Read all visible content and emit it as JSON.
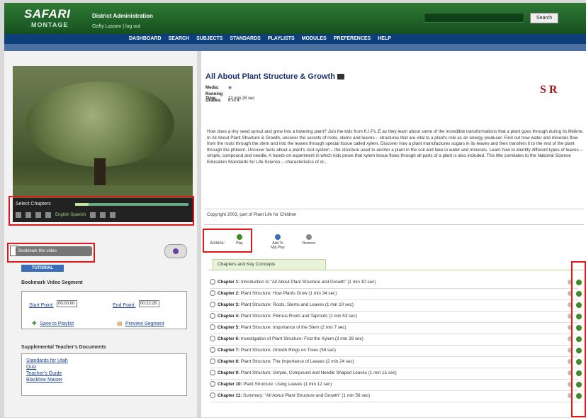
{
  "header": {
    "logo_top": "SAFARI",
    "logo_bottom": "MONTAGE",
    "district": "District Administration",
    "user_line": "Gefty Lassen  |  log out",
    "search_button": "Search"
  },
  "nav": [
    "DASHBOARD",
    "SEARCH",
    "SUBJECTS",
    "STANDARDS",
    "PLAYLISTS",
    "MODULES",
    "PREFERENCES",
    "HELP"
  ],
  "player": {
    "label": "Select  Chapters",
    "language": "English  Spanish",
    "progress": 0.12
  },
  "left": {
    "bookmark_button": "Bookmark this video",
    "tutorial": "TUTORIAL",
    "bookmark_segment_title": "Bookmark Video Segment",
    "start_label": "Start Point:",
    "start_value": "00:00:00",
    "end_label": "End Point:",
    "end_value": "00:22:28",
    "save_link": "Save to Playlist",
    "preview_link": "Preview Segment",
    "docs_title": "Supplemental Teacher's Documents",
    "docs": [
      "Standards for Utah",
      "Quiz",
      "Teacher's Guide",
      "Blackline Master"
    ]
  },
  "video_info": {
    "title": "All About Plant Structure & Growth",
    "media_label": "Media:",
    "running_time_label": "Running Time:",
    "running_time": "22 min 28 sec",
    "grades_label": "Grades:",
    "grades": "K to 4",
    "brand": "S R",
    "description": "How does a tiny seed sprout and grow into a towering plant? Join the kids from K.I.P.L.E as they learn about some of the incredible transformations that a plant goes through during its lifetime. In All About Plant Structure & Growth, uncover the secrets of roots, stems and leaves – structures that are vital to a plant's role as an energy producer. Find out how water and minerals flow from the roots through the stem and into the leaves through special tissue called xylem. Discover how a plant manufactures sugars in its leaves and then transfers it to the rest of the plant through the phloem. Uncover facts about a plant's root system – the structure used to anchor a plant in the soil and take in water and minerals. Learn how to identify different types of leaves – simple, compound and needle. A hands-on experiment in which kids prove that xylem tissue flows through all parts of a plant is also included. This title correlates to the National Science Education Standards for Life Science – characteristics of or...",
    "copyright": "Copyright 2003, part of Plant Life for Children",
    "actions_label": "Actions:",
    "actions": [
      "Play",
      "Add To MyLPlay",
      "Remove"
    ],
    "tab": "Chapters and Key Concepts"
  },
  "chapters": [
    {
      "num": "Chapter 1:",
      "text": "Introduction to \"All About Plant Structure and Growth\" (1 min 10 sec)"
    },
    {
      "num": "Chapter 2:",
      "text": "Plant Structure: How Plants Grow (1 min 34 sec)"
    },
    {
      "num": "Chapter 3:",
      "text": "Plant Structure: Roots, Stems and Leaves (1 min 10 sec)"
    },
    {
      "num": "Chapter 4:",
      "text": "Plant Structure: Fibrous Roots and Taproots (2 min 53 sec)"
    },
    {
      "num": "Chapter 5:",
      "text": "Plant Structure: Importance of the Stem (2 min 7 sec)"
    },
    {
      "num": "Chapter 6:",
      "text": "Investigation of Plant Structure: Find the Xylem (3 min 28 sec)"
    },
    {
      "num": "Chapter 7:",
      "text": "Plant Structure: Growth Rings on Trees (59 sec)"
    },
    {
      "num": "Chapter 8:",
      "text": "Plant Structure: The Importance of Leaves (2 min 24 sec)"
    },
    {
      "num": "Chapter 9:",
      "text": "Plant Structure: Simple, Compound and Needle Shaped Leaves (1 min 15 sec)"
    },
    {
      "num": "Chapter 10:",
      "text": "Plant Structure: Using Leaves (1 min 12 sec)"
    },
    {
      "num": "Chapter 11:",
      "text": "Summary: \"All About Plant Structure and Growth\" (1 min 56 sec)"
    }
  ]
}
